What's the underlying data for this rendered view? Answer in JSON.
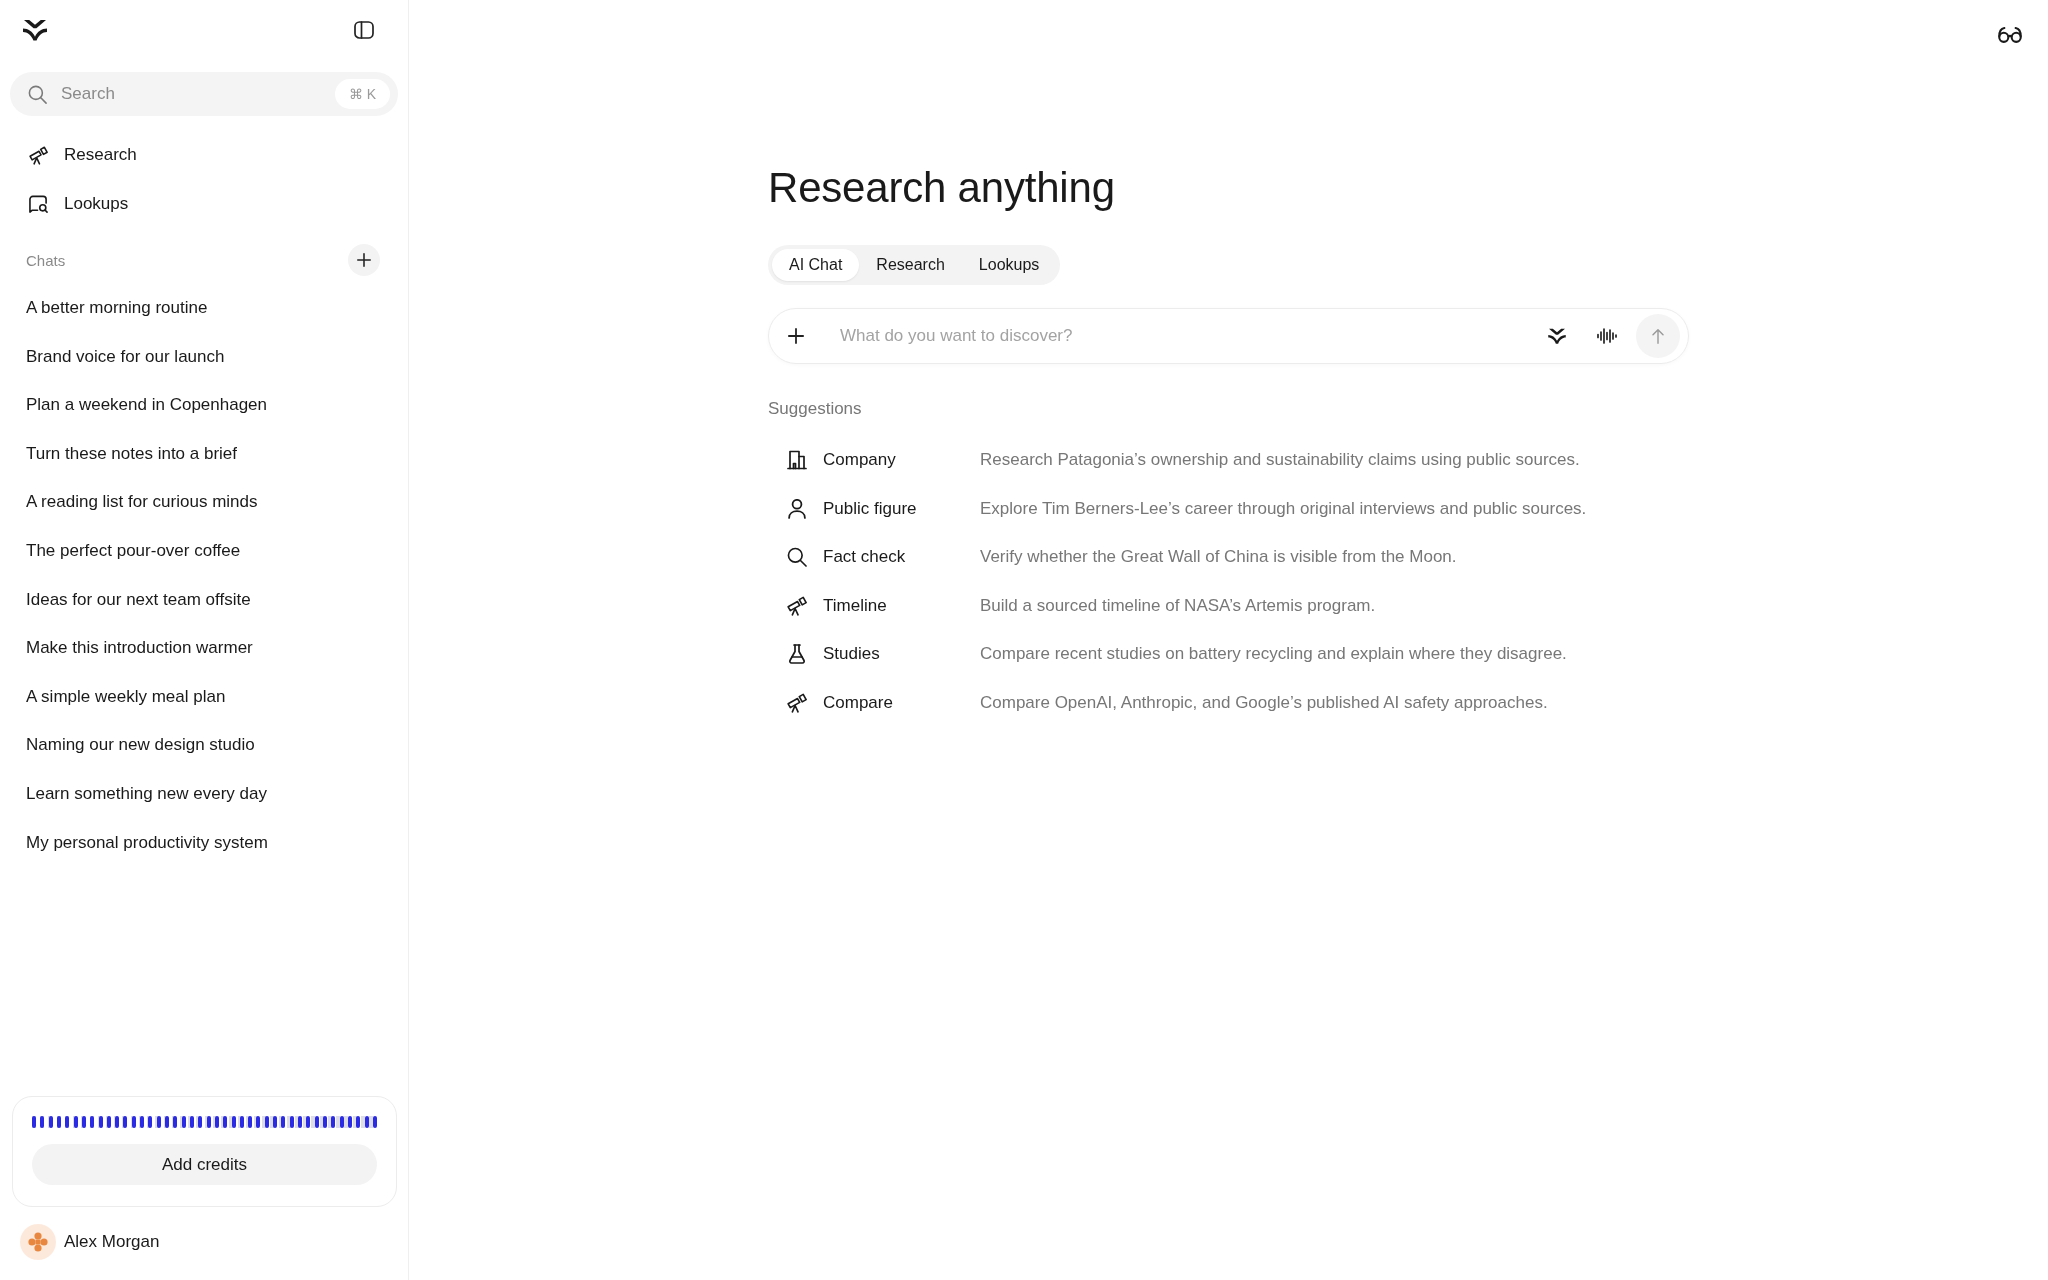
{
  "sidebar": {
    "search": {
      "placeholder": "Search",
      "shortcut": "⌘ K"
    },
    "nav": [
      {
        "kind": "telescope",
        "label": "Research"
      },
      {
        "kind": "lookup",
        "label": "Lookups"
      }
    ],
    "chats_heading": "Chats",
    "chats": [
      "A better morning routine",
      "Brand voice for our launch",
      "Plan a weekend in Copenhagen",
      "Turn these notes into a brief",
      "A reading list for curious minds",
      "The perfect pour-over coffee",
      "Ideas for our next team offsite",
      "Make this introduction warmer",
      "A simple weekly meal plan",
      "Naming our new design studio",
      "Learn something new every day",
      "My personal productivity system"
    ],
    "credits": {
      "level": 1,
      "button": "Add credits"
    },
    "user": {
      "name": "Alex Morgan"
    }
  },
  "main": {
    "title": "Research anything",
    "tabs": [
      {
        "label": "AI Chat",
        "selected": true
      },
      {
        "label": "Research",
        "selected": false
      },
      {
        "label": "Lookups",
        "selected": false
      }
    ],
    "prompt": {
      "placeholder": "What do you want to discover?"
    },
    "suggestions_heading": "Suggestions",
    "suggestions": [
      {
        "kind": "building",
        "label": "Company",
        "text": "Research Patagonia’s ownership and sustainability claims using public sources."
      },
      {
        "kind": "person",
        "label": "Public figure",
        "text": "Explore Tim Berners-Lee’s career through original interviews and public sources."
      },
      {
        "kind": "magnifier",
        "label": "Fact check",
        "text": "Verify whether the Great Wall of China is visible from the Moon."
      },
      {
        "kind": "telescope",
        "label": "Timeline",
        "text": "Build a sourced timeline of NASA’s Artemis program."
      },
      {
        "kind": "flask",
        "label": "Studies",
        "text": "Compare recent studies on battery recycling and explain where they disagree."
      },
      {
        "kind": "telescope",
        "label": "Compare",
        "text": "Compare OpenAI, Anthropic, and Google’s published AI safety approaches."
      }
    ]
  }
}
